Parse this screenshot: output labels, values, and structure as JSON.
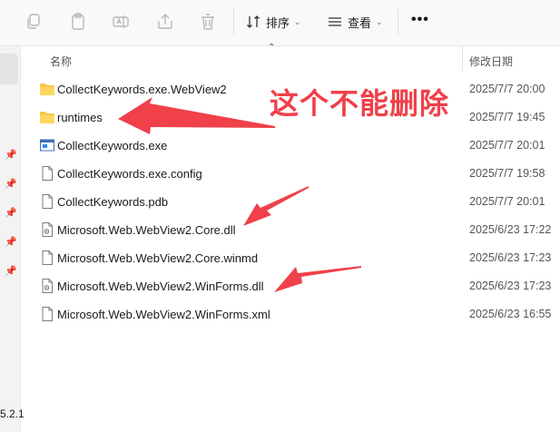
{
  "toolbar": {
    "sort_label": "排序",
    "view_label": "查看",
    "more_label": "•••"
  },
  "columns": {
    "name": "名称",
    "modified": "修改日期"
  },
  "files": [
    {
      "name": "CollectKeywords.exe.WebView2",
      "date": "2025/7/7 20:00",
      "icon": "folder-icon"
    },
    {
      "name": "runtimes",
      "date": "2025/7/7 19:45",
      "icon": "folder-icon"
    },
    {
      "name": "CollectKeywords.exe",
      "date": "2025/7/7 20:01",
      "icon": "exe-icon"
    },
    {
      "name": "CollectKeywords.exe.config",
      "date": "2025/7/7 19:58",
      "icon": "file-icon"
    },
    {
      "name": "CollectKeywords.pdb",
      "date": "2025/7/7 20:01",
      "icon": "file-icon"
    },
    {
      "name": "Microsoft.Web.WebView2.Core.dll",
      "date": "2025/6/23 17:22",
      "icon": "dll-icon"
    },
    {
      "name": "Microsoft.Web.WebView2.Core.winmd",
      "date": "2025/6/23 17:23",
      "icon": "file-icon"
    },
    {
      "name": "Microsoft.Web.WebView2.WinForms.dll",
      "date": "2025/6/23 17:23",
      "icon": "dll-icon"
    },
    {
      "name": "Microsoft.Web.WebView2.WinForms.xml",
      "date": "2025/6/23 16:55",
      "icon": "file-icon"
    }
  ],
  "nav": {
    "version_fragment": "5.2.1"
  },
  "annotation": {
    "text": "这个不能删除",
    "color": "#f0404a"
  }
}
